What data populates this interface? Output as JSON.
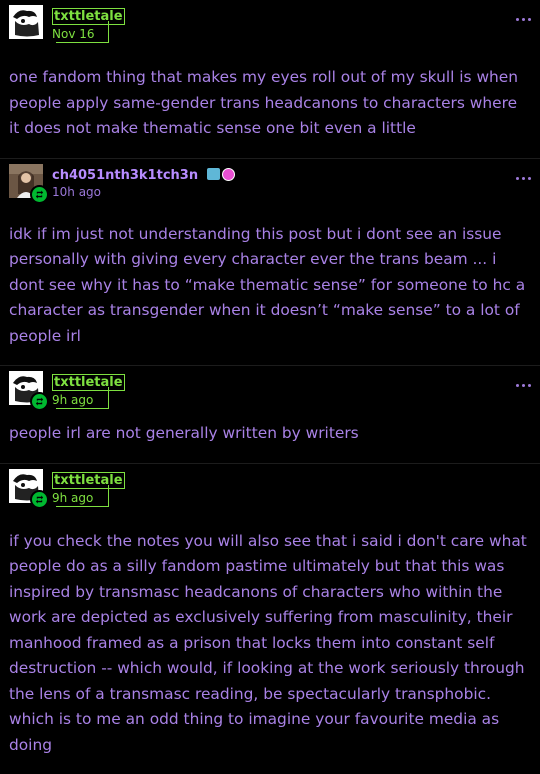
{
  "posts": [
    {
      "username": "txttletale",
      "time": "Nov 16",
      "body": "one fandom thing that makes my eyes roll out of my skull is when people apply same-gender trans headcanons to characters where it does not make thematic sense one bit even a little"
    },
    {
      "username": "ch4051nth3k1tch3n",
      "time": "10h ago",
      "body": "idk if im just not understanding this post but i dont see an issue personally with giving every character ever the trans beam ... i dont see why it has to “make thematic sense” for someone to hc a character as transgender when it doesn’t “make sense” to a lot of people irl"
    },
    {
      "username": "txttletale",
      "time": "9h ago",
      "body": "people irl are not generally written by writers"
    },
    {
      "username": "txttletale",
      "time": "9h ago",
      "body": "if you check the notes you will also see that i said i don't care what people do as a silly fandom pastime ultimately but that this was inspired by transmasc headcanons of characters who within the work are depicted as exclusively suffering from masculinity, their manhood framed as a prison that locks them into constant self destruction -- which would, if looking at the work seriously through the lens of a transmasc reading, be spectacularly transphobic. which is to me an odd thing to imagine your favourite media as doing"
    }
  ],
  "icons": {
    "more": "more-options-icon",
    "reblog": "reblog-icon"
  },
  "colors": {
    "background": "#000000",
    "text": "#a982e6",
    "username_accent": "#7ee040",
    "reblog_badge": "#00b830"
  }
}
